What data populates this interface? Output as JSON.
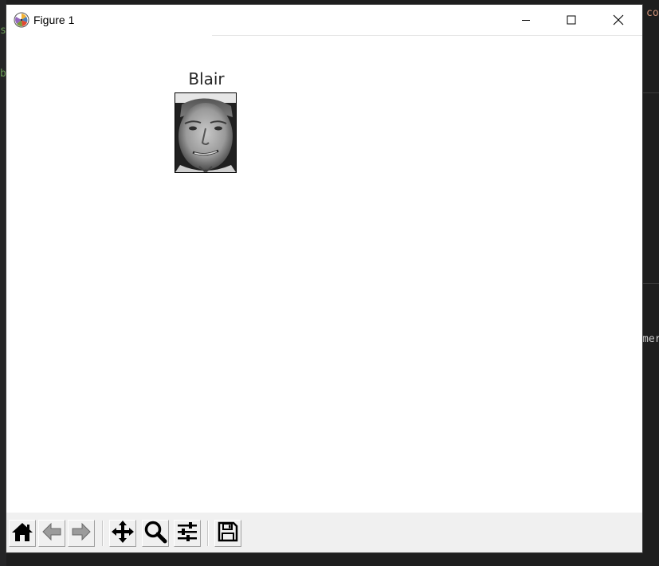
{
  "window": {
    "title": "Figure 1",
    "icons": {
      "app": "matplotlib-logo-icon",
      "minimize": "minimize-icon",
      "maximize": "maximize-icon",
      "close": "close-icon"
    }
  },
  "background_editor": {
    "fragments": [
      "co",
      "s",
      "b",
      "mer"
    ],
    "colors": {
      "orange": "#ce9178",
      "green": "#6a9955",
      "text": "#cccccc",
      "bg": "#1e1e1e"
    }
  },
  "plot": {
    "title": "Blair",
    "image": "grayscale face photo"
  },
  "toolbar": {
    "buttons": [
      {
        "name": "home-button",
        "icon": "home-icon"
      },
      {
        "name": "back-button",
        "icon": "arrow-left-icon"
      },
      {
        "name": "forward-button",
        "icon": "arrow-right-icon"
      },
      {
        "name": "pan-button",
        "icon": "move-arrows-icon"
      },
      {
        "name": "zoom-button",
        "icon": "magnifier-icon"
      },
      {
        "name": "configure-subplots-button",
        "icon": "sliders-icon"
      },
      {
        "name": "save-button",
        "icon": "floppy-disk-icon"
      }
    ]
  }
}
